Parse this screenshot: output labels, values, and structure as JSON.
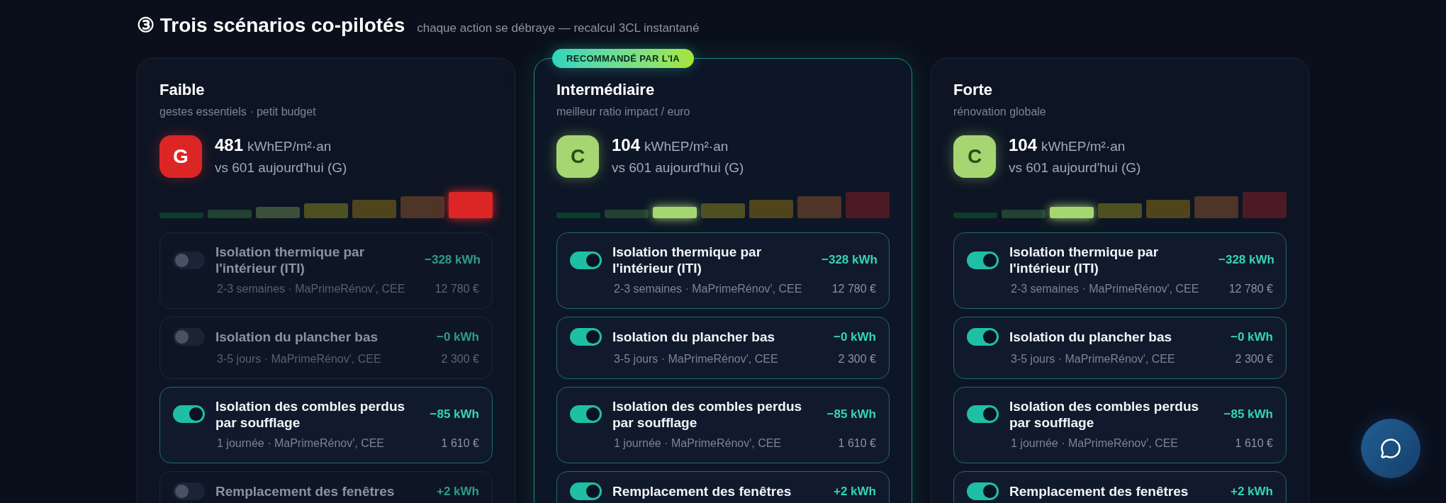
{
  "header": {
    "title": "③ Trois scénarios co-pilotés",
    "subtitle": "chaque action se débraye — recalcul 3CL instantané"
  },
  "scenarios": [
    {
      "title": "Faible",
      "subtitle": "gestes essentiels · petit budget",
      "recommended": false,
      "grade": "G",
      "consumption": "481",
      "unit": "kWhEP/m²·an",
      "comparison": "vs 601 aujourd'hui (G)",
      "scale": [
        {
          "selected": false
        },
        {
          "selected": false
        },
        {
          "selected": false
        },
        {
          "selected": false
        },
        {
          "selected": false
        },
        {
          "selected": false
        },
        {
          "selected": true
        }
      ],
      "actions": [
        {
          "title": "Isolation thermique par l'intérieur (ITI)",
          "on": false,
          "saving": "−328 kWh",
          "meta": "2-3 semaines · MaPrimeRénov', CEE",
          "price": "12 780 €"
        },
        {
          "title": "Isolation du plancher bas",
          "on": false,
          "saving": "−0 kWh",
          "meta": "3-5 jours · MaPrimeRénov', CEE",
          "price": "2 300 €"
        },
        {
          "title": "Isolation des combles perdus par soufflage",
          "on": true,
          "saving": "−85 kWh",
          "meta": "1 journée · MaPrimeRénov', CEE",
          "price": "1 610 €"
        },
        {
          "title": "Remplacement des fenêtres",
          "on": false,
          "saving": "+2 kWh"
        }
      ]
    },
    {
      "badge": "RECOMMANDÉ PAR L'IA",
      "title": "Intermédiaire",
      "subtitle": "meilleur ratio impact / euro",
      "recommended": true,
      "grade": "C",
      "consumption": "104",
      "unit": "kWhEP/m²·an",
      "comparison": "vs 601 aujourd'hui (G)",
      "scale": [
        {
          "selected": false
        },
        {
          "selected": false
        },
        {
          "selected": true
        },
        {
          "selected": false
        },
        {
          "selected": false
        },
        {
          "selected": false
        },
        {
          "selected": false
        }
      ],
      "actions": [
        {
          "title": "Isolation thermique par l'intérieur (ITI)",
          "on": true,
          "saving": "−328 kWh",
          "meta": "2-3 semaines · MaPrimeRénov', CEE",
          "price": "12 780 €"
        },
        {
          "title": "Isolation du plancher bas",
          "on": true,
          "saving": "−0 kWh",
          "meta": "3-5 jours · MaPrimeRénov', CEE",
          "price": "2 300 €"
        },
        {
          "title": "Isolation des combles perdus par soufflage",
          "on": true,
          "saving": "−85 kWh",
          "meta": "1 journée · MaPrimeRénov', CEE",
          "price": "1 610 €"
        },
        {
          "title": "Remplacement des fenêtres",
          "on": true,
          "saving": "+2 kWh"
        }
      ]
    },
    {
      "title": "Forte",
      "subtitle": "rénovation globale",
      "recommended": false,
      "grade": "C",
      "consumption": "104",
      "unit": "kWhEP/m²·an",
      "comparison": "vs 601 aujourd'hui (G)",
      "scale": [
        {
          "selected": false
        },
        {
          "selected": false
        },
        {
          "selected": true
        },
        {
          "selected": false
        },
        {
          "selected": false
        },
        {
          "selected": false
        },
        {
          "selected": false
        }
      ],
      "actions": [
        {
          "title": "Isolation thermique par l'intérieur (ITI)",
          "on": true,
          "saving": "−328 kWh",
          "meta": "2-3 semaines · MaPrimeRénov', CEE",
          "price": "12 780 €"
        },
        {
          "title": "Isolation du plancher bas",
          "on": true,
          "saving": "−0 kWh",
          "meta": "3-5 jours · MaPrimeRénov', CEE",
          "price": "2 300 €"
        },
        {
          "title": "Isolation des combles perdus par soufflage",
          "on": true,
          "saving": "−85 kWh",
          "meta": "1 journée · MaPrimeRénov', CEE",
          "price": "1 610 €"
        },
        {
          "title": "Remplacement des fenêtres",
          "on": true,
          "saving": "+2 kWh"
        }
      ]
    }
  ]
}
